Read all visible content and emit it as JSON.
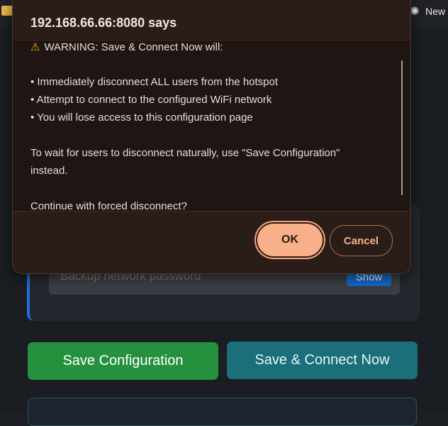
{
  "browser": {
    "tab_right_label": "New"
  },
  "page": {
    "backup_password_placeholder": "Backup network password",
    "show_label": "Show",
    "save_configuration_label": "Save Configuration",
    "save_connect_label": "Save & Connect Now"
  },
  "dialog": {
    "title": "192.168.66.66:8080 says",
    "warning_icon": "warning-triangle-icon",
    "lines": [
      "WARNING: Save & Connect Now will:",
      "• Immediately disconnect ALL users from the hotspot",
      "• Attempt to connect to the configured WiFi network",
      "• You will lose access to this configuration page",
      "To wait for users to disconnect naturally, use \"Save Configuration\"",
      "instead.",
      "Continue with forced disconnect?"
    ],
    "ok_label": "OK",
    "cancel_label": "Cancel"
  },
  "colors": {
    "dialog_bg": "#2a1d18",
    "ok_accent": "#f7b08a",
    "save_green": "#25913f",
    "connect_teal": "#1a6f7a",
    "show_blue": "#1565c0"
  }
}
